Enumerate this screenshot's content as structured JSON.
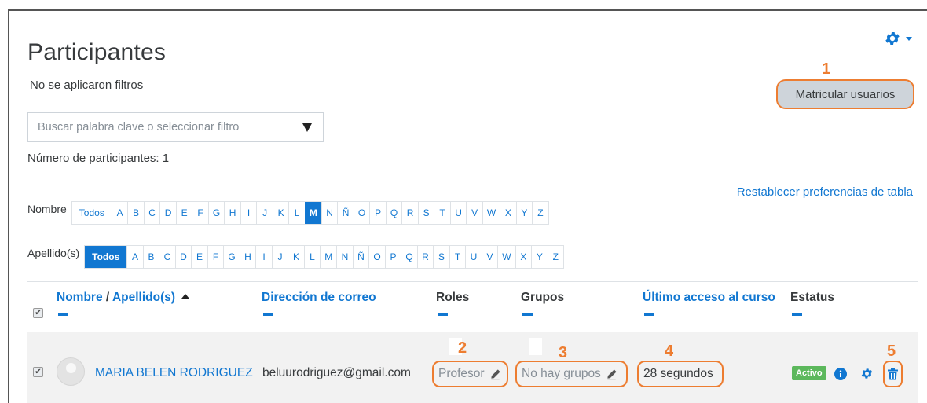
{
  "page": {
    "title": "Participantes",
    "filters_status": "No se aplicaron filtros",
    "participant_count": "Número de participantes: 1"
  },
  "toolbar": {
    "enrol_button": "Matricular usuarios",
    "settings_icon": "gear-icon"
  },
  "search": {
    "placeholder": "Buscar palabra clave o seleccionar filtro"
  },
  "table_prefs": {
    "reset_link": "Restablecer preferencias de tabla"
  },
  "initials": {
    "first_name_label": "Nombre",
    "last_name_label": "Apellido(s)",
    "all_label": "Todos",
    "letters": [
      "A",
      "B",
      "C",
      "D",
      "E",
      "F",
      "G",
      "H",
      "I",
      "J",
      "K",
      "L",
      "M",
      "N",
      "Ñ",
      "O",
      "P",
      "Q",
      "R",
      "S",
      "T",
      "U",
      "V",
      "W",
      "X",
      "Y",
      "Z"
    ],
    "first_name_selected": "M",
    "last_name_selected": "Todos"
  },
  "table": {
    "headers": {
      "name": "Nombre",
      "separator": "/",
      "surname": "Apellido(s)",
      "email": "Dirección de correo",
      "roles": "Roles",
      "groups": "Grupos",
      "last_access": "Último acceso al curso",
      "status": "Estatus"
    },
    "rows": [
      {
        "name": "MARIA BELEN RODRIGUEZ",
        "email": "beluurodriguez@gmail.com",
        "role": "Profesor",
        "groups": "No hay grupos",
        "last_access": "28 segundos",
        "status": "Activo"
      }
    ]
  },
  "annotations": {
    "n1": "1",
    "n2": "2",
    "n3": "3",
    "n4": "4",
    "n5": "5",
    "color": "#ed7d31"
  },
  "colors": {
    "accent": "#1177d1",
    "active_badge": "#5cb85c",
    "callout": "#ed7d31"
  }
}
